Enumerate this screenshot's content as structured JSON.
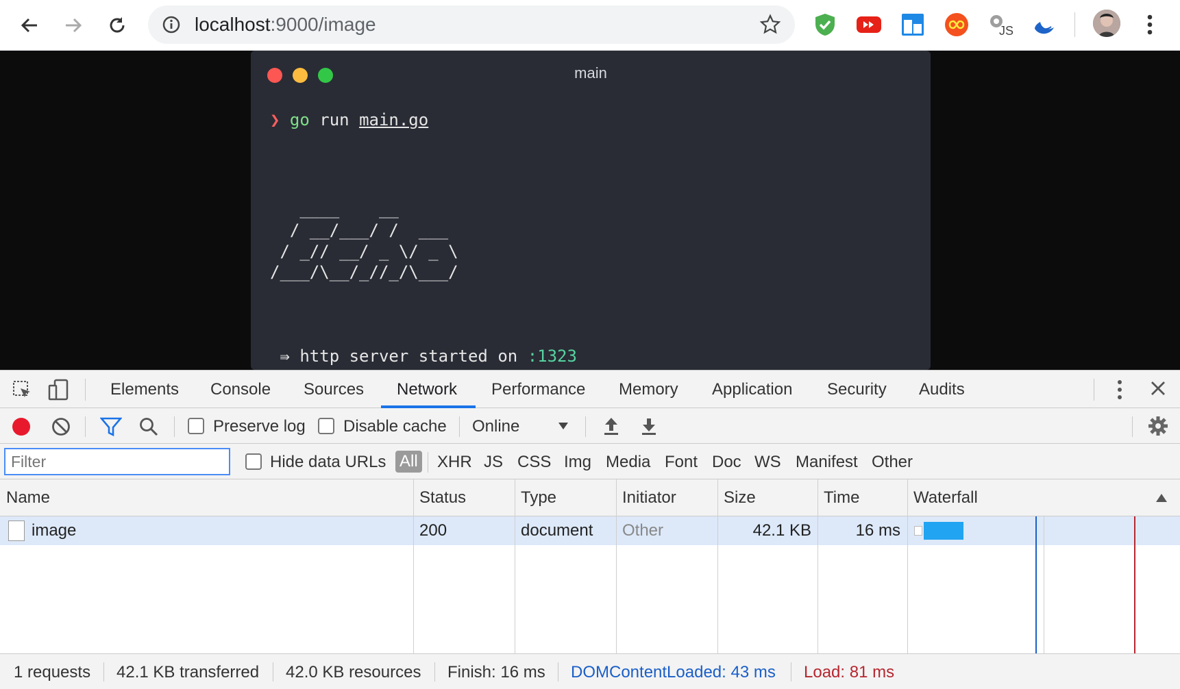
{
  "browser": {
    "url_host": "localhost",
    "url_rest": ":9000/image"
  },
  "terminal": {
    "title": "main",
    "prompt_symbol": "❯",
    "command": "go",
    "command_args": " run ",
    "command_file": "main.go",
    "banner_lines": [
      "   ____    __",
      "  / __/___/ /  ___",
      " / _// __/ _ \\/ _ \\",
      "/___/\\__/_//_/\\___/"
    ],
    "server_prefix": " ⇛ http server started on ",
    "server_port": ":1323"
  },
  "devtools": {
    "tabs": [
      "Elements",
      "Console",
      "Sources",
      "Network",
      "Performance",
      "Memory",
      "Application",
      "Security",
      "Audits"
    ],
    "active_tab": "Network",
    "preserve_log_label": "Preserve log",
    "disable_cache_label": "Disable cache",
    "throttle_value": "Online",
    "filter_placeholder": "Filter",
    "hide_data_urls_label": "Hide data URLs",
    "type_filters": [
      "All",
      "XHR",
      "JS",
      "CSS",
      "Img",
      "Media",
      "Font",
      "Doc",
      "WS",
      "Manifest",
      "Other"
    ],
    "columns": [
      "Name",
      "Status",
      "Type",
      "Initiator",
      "Size",
      "Time",
      "Waterfall"
    ],
    "rows": [
      {
        "name": "image",
        "status": "200",
        "type": "document",
        "initiator": "Other",
        "size": "42.1 KB",
        "time": "16 ms"
      }
    ],
    "status": {
      "requests": "1 requests",
      "transferred": "42.1 KB transferred",
      "resources": "42.0 KB resources",
      "finish": "Finish: 16 ms",
      "dom_content_loaded": "DOMContentLoaded: 43 ms",
      "load": "Load: 81 ms"
    }
  },
  "colors": {
    "accent": "#1a73e8",
    "record": "#e8192c",
    "waterfall_bar": "#21a4f1",
    "dcl_line": "#1a5fc8",
    "load_line": "#b5262f"
  }
}
